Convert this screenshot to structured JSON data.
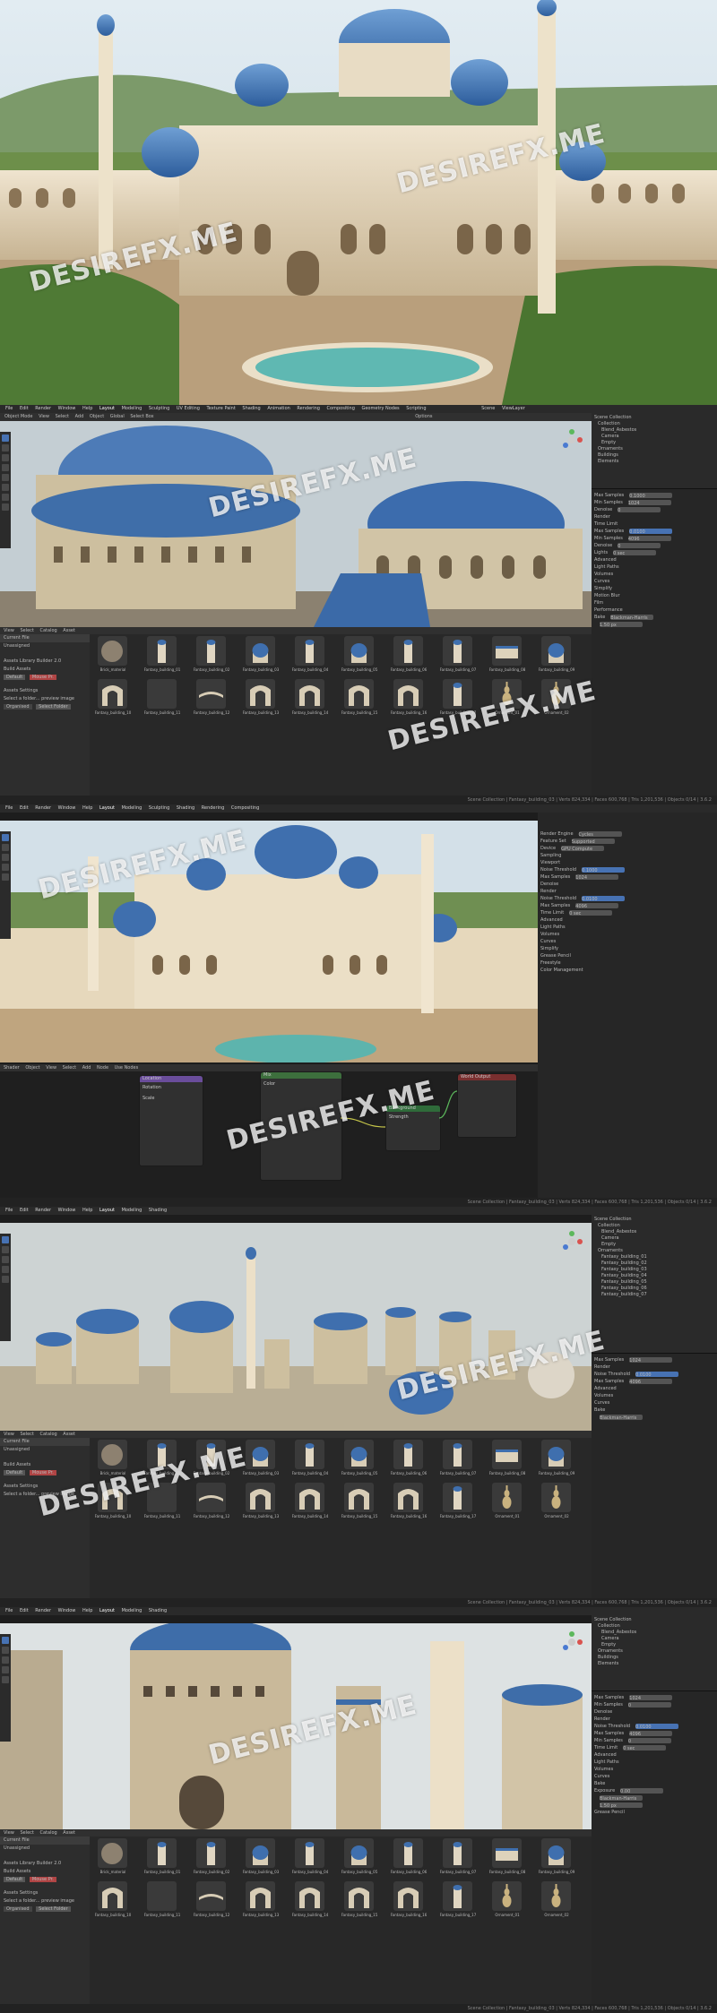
{
  "watermark": "DESIREFX.ME",
  "topbar": {
    "menus": [
      "File",
      "Edit",
      "Render",
      "Window",
      "Help"
    ],
    "workspaces": [
      "Layout",
      "Modeling",
      "Sculpting",
      "UV Editing",
      "Texture Paint",
      "Shading",
      "Animation",
      "Rendering",
      "Compositing",
      "Geometry Nodes",
      "Scripting"
    ],
    "scene": "Scene",
    "view_layer": "ViewLayer"
  },
  "toolbar": {
    "items": [
      "Object Mode",
      "View",
      "Select",
      "Add",
      "Object",
      "Global",
      "Select Box",
      "Options"
    ]
  },
  "outliner": {
    "items": [
      "Scene Collection",
      "Collection",
      "Blend_Asbestos",
      "Camera",
      "Empty",
      "Ornaments",
      "Buildings",
      "Elements"
    ]
  },
  "render_props": {
    "render_engine": "Cycles",
    "feature_set": "Supported",
    "device": "GPU Compute",
    "sections": [
      "Sampling",
      "Viewport",
      "Noise Threshold",
      "Max Samples",
      "Min Samples",
      "Denoise",
      "Render",
      "Time Limit",
      "Lights",
      "Advanced",
      "Light Paths",
      "Volumes",
      "Curves",
      "Simplify",
      "Motion Blur",
      "Film",
      "Performance",
      "Bake",
      "Grease Pencil",
      "Freestyle",
      "Color Management"
    ],
    "values": [
      "0.1000",
      "1024",
      "0",
      "0.0100",
      "4096",
      "0",
      "0 sec"
    ],
    "film_filter": "Blackman-Harris",
    "film_width": "1.50 px",
    "exposure": "0.00"
  },
  "asset_browser": {
    "menus": [
      "View",
      "Select",
      "Catalog",
      "Asset"
    ],
    "sidebar": [
      "Current File",
      "Unassigned",
      "Assets Library Builder 2.0",
      "Build Assets",
      "Default",
      "Mouse Pr.",
      "Assets Settings",
      "Select a folder... preview image",
      "Organised",
      "Select Folder"
    ],
    "assets": [
      "Brick_material",
      "Fantasy_building_01",
      "Fantasy_building_02",
      "Fantasy_building_03",
      "Fantasy_building_04",
      "Fantasy_building_05",
      "Fantasy_building_06",
      "Fantasy_building_07",
      "Fantasy_building_08",
      "Fantasy_building_09",
      "Fantasy_building_10",
      "Fantasy_building_11",
      "Fantasy_building_12",
      "Fantasy_building_13",
      "Fantasy_building_14",
      "Fantasy_building_15",
      "Fantasy_building_16",
      "Fantasy_building_17",
      "Ornament_01",
      "Ornament_02"
    ]
  },
  "node_editor": {
    "menus": [
      "Shader",
      "Object",
      "View",
      "Select",
      "Add",
      "Node",
      "Use Nodes"
    ],
    "nodes": [
      "Location",
      "Rotation",
      "Scale",
      "Mix",
      "Background",
      "World Output",
      "Color",
      "Strength"
    ]
  },
  "status": "Scene Collection | Fantasy_building_03 | Verts 824,334 | Faces 600,768 | Tris 1,201,536 | Objects 0/14 | 3.6.2"
}
